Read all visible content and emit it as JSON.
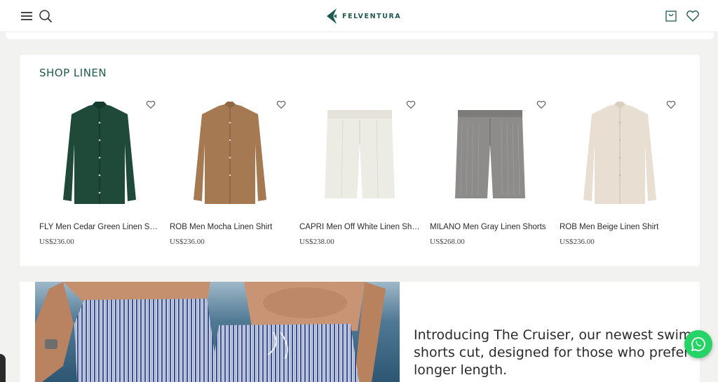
{
  "header": {
    "logo_text": "FELVENTURA",
    "menu_icon": "hamburger-menu-icon",
    "search_icon": "search-icon",
    "cart_icon": "shopping-bag-icon",
    "wishlist_icon": "heart-icon",
    "brand_color": "#1e5a4e"
  },
  "shop": {
    "title": "SHOP LINEN",
    "products": [
      {
        "name": "FLY Men Cedar Green Linen Shirt",
        "price": "US$236.00",
        "color": "#1f4a3a"
      },
      {
        "name": "ROB Men Mocha Linen Shirt",
        "price": "US$236.00",
        "color": "#a57a52"
      },
      {
        "name": "CAPRI Men Off White Linen Shorts",
        "price": "US$238.00",
        "color": "#ecebe4"
      },
      {
        "name": "MILANO Men Gray Linen Shorts",
        "price": "US$268.00",
        "color": "#8d8c8a"
      },
      {
        "name": "ROB Men Beige Linen Shirt",
        "price": "US$236.00",
        "color": "#e8dfd2"
      }
    ]
  },
  "banner": {
    "text": "Introducing The Cruiser, our newest swim shorts cut, designed for those who prefer a longer length."
  },
  "whatsapp": {
    "icon": "whatsapp-icon",
    "color": "#25d366"
  }
}
